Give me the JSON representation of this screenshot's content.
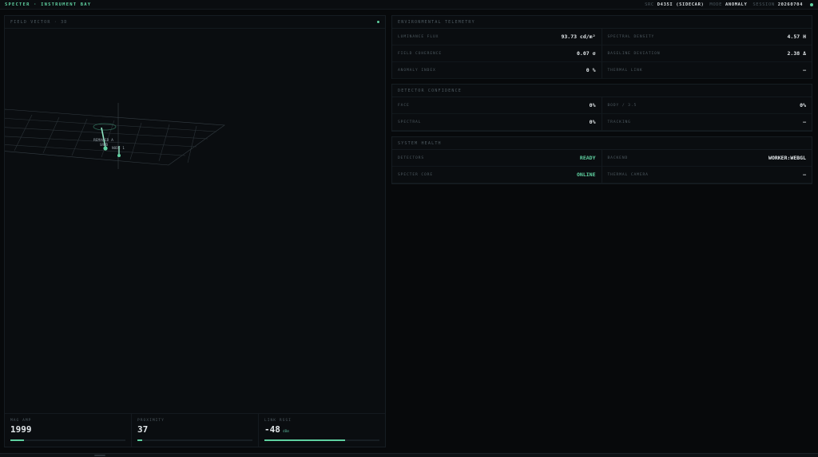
{
  "header": {
    "title": "SPECTER · INSTRUMENT BAY",
    "src_key": "SRC",
    "src_val": "D435I (SIDECAR)",
    "mode_key": "MODE",
    "mode_val": "ANOMALY",
    "session_key": "SESSION",
    "session_val": "20260704"
  },
  "field": {
    "title": "FIELD VECTOR · 3D",
    "tags": [
      "REMAPED A",
      "SRMD",
      "NODE 1"
    ],
    "metrics": [
      {
        "label": "MAG AMP",
        "value": "1999",
        "unit": "",
        "fill": 0.12
      },
      {
        "label": "PROXIMITY",
        "value": "37",
        "unit": "",
        "fill": 0.04
      },
      {
        "label": "LINK RSSI",
        "value": "-48",
        "unit": "dBm",
        "fill": 0.7
      }
    ]
  },
  "env": {
    "title": "ENVIRONMENTAL TELEMETRY",
    "cells": [
      {
        "label": "LUMINANCE FLUX",
        "value": "93.73 cd/m²"
      },
      {
        "label": "SPECTRAL DENSITY",
        "value": "4.57 H"
      },
      {
        "label": "FIELD COHERENCE",
        "value": "0.07 σ"
      },
      {
        "label": "BASELINE DEVIATION",
        "value": "2.38 Δ"
      },
      {
        "label": "ANOMALY INDEX",
        "value": "0 %"
      },
      {
        "label": "THERMAL LINK",
        "value": "—"
      }
    ]
  },
  "detector": {
    "title": "DETECTOR CONFIDENCE",
    "cells": [
      {
        "label": "FACE",
        "value": "0%"
      },
      {
        "label": "BODY / 3.5",
        "value": "0%"
      },
      {
        "label": "SPECTRAL",
        "value": "0%"
      },
      {
        "label": "TRACKING",
        "value": "—"
      }
    ]
  },
  "system": {
    "title": "SYSTEM HEALTH",
    "cells": [
      {
        "label": "DETECTORS",
        "value": "READY"
      },
      {
        "label": "BACKEND",
        "value": "WORKER:WEBGL"
      },
      {
        "label": "SPECTER CORE",
        "value": "ONLINE"
      },
      {
        "label": "THERMAL CAMERA",
        "value": "—"
      }
    ]
  },
  "colors": {
    "accent": "#5fd0a0",
    "background": "#07090b",
    "panel": "#0a0d10"
  }
}
